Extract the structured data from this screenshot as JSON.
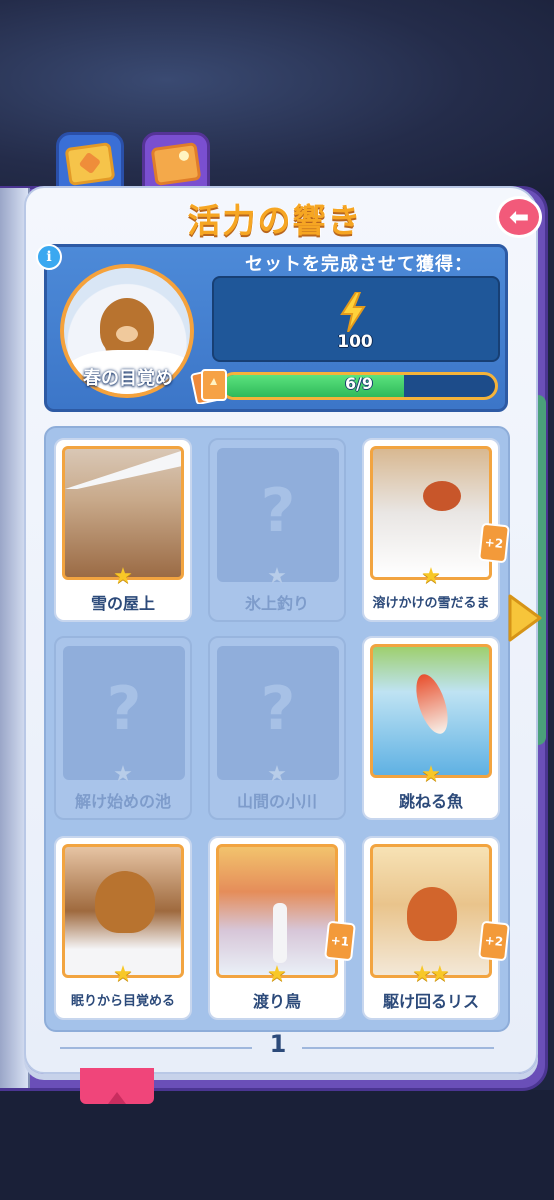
{
  "header": {
    "title": "活力の響き",
    "back_icon": "arrow-left-icon"
  },
  "tabs": [
    {
      "icon": "cards-tab-icon"
    },
    {
      "icon": "photos-tab-icon"
    }
  ],
  "album": {
    "name": "春の目覚め",
    "reward_label": "セットを完成させて獲得：",
    "reward_icon": "lightning-bolt-icon",
    "reward_value": "100",
    "progress_text": "6/9",
    "progress_fraction": 0.667
  },
  "cards": [
    {
      "name": "雪の屋上",
      "stars": "★",
      "locked": false,
      "art": "snowy-roof",
      "badge": ""
    },
    {
      "name": "氷上釣り",
      "stars": "★",
      "locked": true,
      "art": "",
      "badge": ""
    },
    {
      "name": "溶けかけの雪だるま",
      "stars": "★",
      "locked": false,
      "art": "red-panda-snowman",
      "badge": "+2"
    },
    {
      "name": "解け始めの池",
      "stars": "★",
      "locked": true,
      "art": "",
      "badge": ""
    },
    {
      "name": "山間の小川",
      "stars": "★",
      "locked": true,
      "art": "",
      "badge": ""
    },
    {
      "name": "跳ねる魚",
      "stars": "★",
      "locked": false,
      "art": "jumping-fish",
      "badge": ""
    },
    {
      "name": "眠りから目覚める",
      "stars": "★",
      "locked": false,
      "art": "groundhog-awakening",
      "badge": ""
    },
    {
      "name": "渡り鳥",
      "stars": "★",
      "locked": false,
      "art": "migratory-birds",
      "badge": "+1"
    },
    {
      "name": "駆け回るリス",
      "stars": "★★",
      "locked": false,
      "art": "running-squirrel",
      "badge": "+2"
    }
  ],
  "locked_symbol": "?",
  "pagination": {
    "current_page": "1"
  },
  "colors": {
    "accent_orange": "#f6a623",
    "header_blue": "#3c76c8",
    "progress_green": "#2fb95a",
    "back_button": "#f25a7a"
  }
}
